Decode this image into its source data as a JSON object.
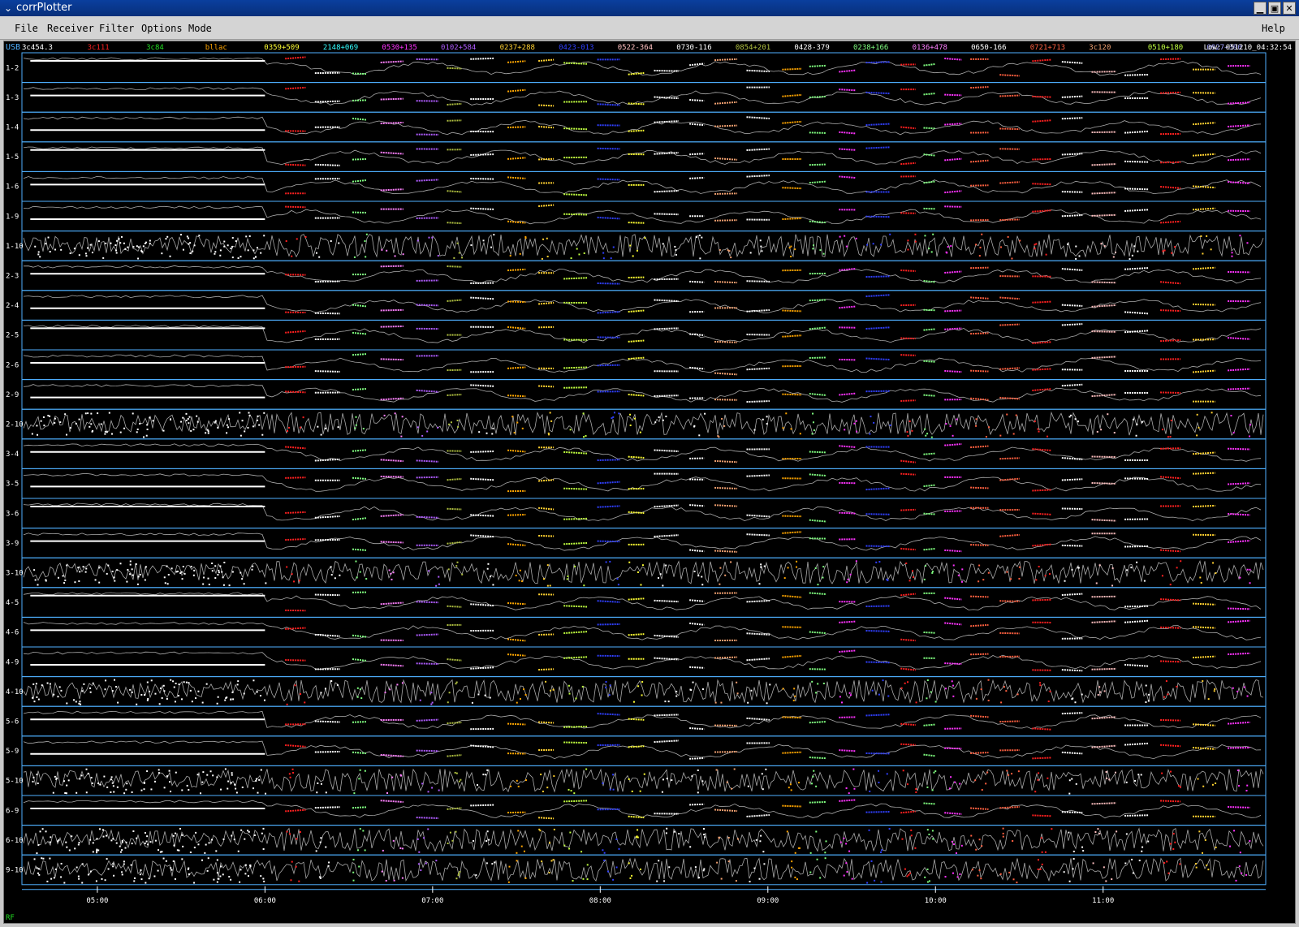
{
  "window": {
    "title": "corrPlotter",
    "buttons": {
      "minimize": "▁",
      "maximize": "▣",
      "close": "✕"
    }
  },
  "menubar": {
    "items": [
      "File",
      "Receiver",
      "Filter",
      "Options",
      "Mode"
    ],
    "help": "Help"
  },
  "plot": {
    "sideband": "USB",
    "timestamp": "Low: 051210_04:32:54",
    "footer_label": "RF",
    "sources": [
      {
        "name": "3c454.3",
        "color": "#ffffff"
      },
      {
        "name": "3c111",
        "color": "#ff2020"
      },
      {
        "name": "3c84",
        "color": "#22dd22"
      },
      {
        "name": "bllac",
        "color": "#ffa500"
      },
      {
        "name": "0359+509",
        "color": "#ffff33"
      },
      {
        "name": "2148+069",
        "color": "#33ffff"
      },
      {
        "name": "0530+135",
        "color": "#ff33ff"
      },
      {
        "name": "0102+584",
        "color": "#b05cff"
      },
      {
        "name": "0237+288",
        "color": "#ffd030"
      },
      {
        "name": "0423-013",
        "color": "#3040ff"
      },
      {
        "name": "0522-364",
        "color": "#ffc0c0"
      },
      {
        "name": "0730-116",
        "color": "#ffffff"
      },
      {
        "name": "0854+201",
        "color": "#b0c040"
      },
      {
        "name": "0428-379",
        "color": "#ffffff"
      },
      {
        "name": "0238+166",
        "color": "#80ff80"
      },
      {
        "name": "0136+478",
        "color": "#ff80ff"
      },
      {
        "name": "0650-166",
        "color": "#ffffff"
      },
      {
        "name": "0721+713",
        "color": "#ff6040"
      },
      {
        "name": "3c120",
        "color": "#f0a070"
      },
      {
        "name": "0510+180",
        "color": "#c0ff40"
      },
      {
        "name": "0927+390",
        "color": "#a0a0ff"
      }
    ],
    "baselines": [
      "1-2",
      "1-3",
      "1-4",
      "1-5",
      "1-6",
      "1-9",
      "1-10",
      "2-3",
      "2-4",
      "2-5",
      "2-6",
      "2-9",
      "2-10",
      "3-4",
      "3-5",
      "3-6",
      "3-9",
      "3-10",
      "4-5",
      "4-6",
      "4-9",
      "4-10",
      "5-6",
      "5-9",
      "5-10",
      "6-9",
      "6-10",
      "9-10"
    ],
    "time_ticks": [
      "05:00",
      "06:00",
      "07:00",
      "08:00",
      "09:00",
      "10:00",
      "11:00"
    ],
    "time_range_hours": [
      4.55,
      11.97
    ],
    "colors": {
      "panel_border": "#4fb0ff",
      "trace": "#aaaaaa",
      "background": "#000000",
      "label": "#ffffff"
    }
  }
}
